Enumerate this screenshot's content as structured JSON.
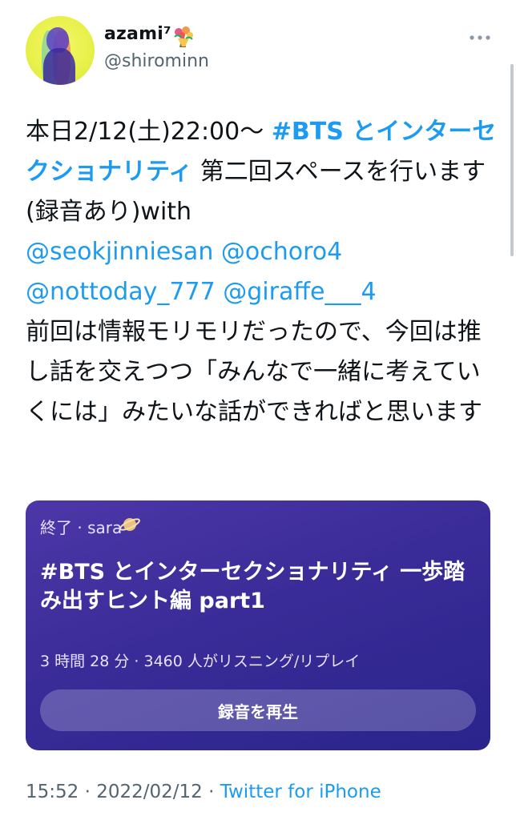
{
  "user": {
    "display_name": "azami⁷",
    "handle": "@shirominn",
    "avatar_icon": "avatar-image",
    "badge_icon": "bouquet-icon"
  },
  "menu_icon": "more-horizontal-icon",
  "tweet": {
    "date_prefix": "本日2/12(土)22:00～",
    "hashtag": "#BTS とインターセクショナリティ",
    "text_after_hashtag": " 第二回スペースを行います (録音あり)with",
    "mentions": [
      "@seokjinniesan",
      "@ochoro4",
      "@nottoday_777",
      "@giraffe___4"
    ],
    "body": "前回は情報モリモリだったので、今回は推し話を交えつつ「みんなで一緒に考えていくには」みたいな話ができればと思います"
  },
  "space_card": {
    "status": "終了 · sara",
    "status_icon": "planet-icon",
    "title": "#BTS とインターセクショナリティ 一歩踏み出すヒント編 part1",
    "stats": "3 時間 28 分 ·  3460 人がリスニング/リプレイ",
    "play_label": "録音を再生"
  },
  "meta": {
    "time": "15:52",
    "separator": " · ",
    "date": "2022/02/12",
    "source": "Twitter for iPhone"
  },
  "colors": {
    "link": "#1d9bf0",
    "card_start": "#4d37a8",
    "card_end": "#2a248c",
    "secondary_text": "#536471"
  }
}
